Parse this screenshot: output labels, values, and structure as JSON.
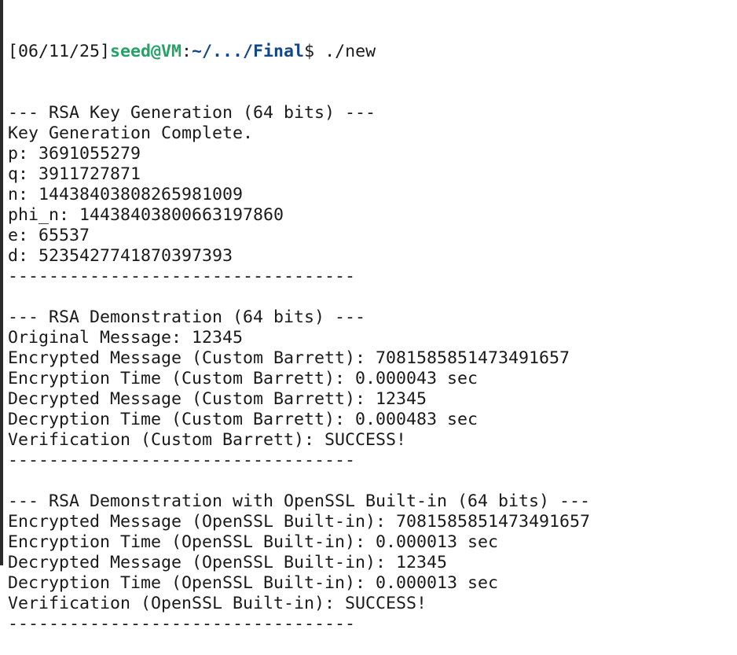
{
  "prompt": {
    "date": "[06/11/25]",
    "user_host": "seed@VM",
    "separator": ":",
    "path": "~/.../Final",
    "symbol": "$",
    "command": " ./new"
  },
  "colors": {
    "user_host": "#26a269",
    "path": "#12488b",
    "text": "#1a1a1a",
    "background": "#ffffff"
  },
  "output_lines": [
    "--- RSA Key Generation (64 bits) ---",
    "Key Generation Complete.",
    "p: 3691055279",
    "q: 3911727871",
    "n: 14438403808265981009",
    "phi_n: 14438403800663197860",
    "e: 65537",
    "d: 5235427741870397393",
    "----------------------------------",
    "",
    "--- RSA Demonstration (64 bits) ---",
    "Original Message: 12345",
    "Encrypted Message (Custom Barrett): 7081585851473491657",
    "Encryption Time (Custom Barrett): 0.000043 sec",
    "Decrypted Message (Custom Barrett): 12345",
    "Decryption Time (Custom Barrett): 0.000483 sec",
    "Verification (Custom Barrett): SUCCESS!",
    "----------------------------------",
    "",
    "--- RSA Demonstration with OpenSSL Built-in (64 bits) ---",
    "Encrypted Message (OpenSSL Built-in): 7081585851473491657",
    "Encryption Time (OpenSSL Built-in): 0.000013 sec",
    "Decrypted Message (OpenSSL Built-in): 12345",
    "Decryption Time (OpenSSL Built-in): 0.000013 sec",
    "Verification (OpenSSL Built-in): SUCCESS!",
    "----------------------------------"
  ]
}
